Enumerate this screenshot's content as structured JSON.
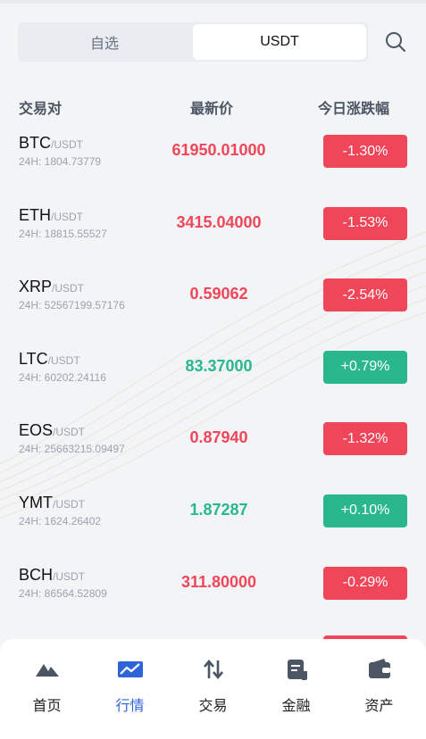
{
  "tabs": [
    {
      "label": "自选",
      "active": false
    },
    {
      "label": "USDT",
      "active": true
    }
  ],
  "header": {
    "pair": "交易对",
    "price": "最新价",
    "change": "今日涨跌幅"
  },
  "colors": {
    "up": "#2bb78d",
    "down": "#f0465a",
    "nav_active": "#2f64d8",
    "icon": "#4b5563"
  },
  "markets": [
    {
      "base": "BTC",
      "quote": "/USDT",
      "volume": "24H: 1804.73779",
      "price": "61950.01000",
      "change": "-1.30%",
      "direction": "down"
    },
    {
      "base": "ETH",
      "quote": "/USDT",
      "volume": "24H: 18815.55527",
      "price": "3415.04000",
      "change": "-1.53%",
      "direction": "down"
    },
    {
      "base": "XRP",
      "quote": "/USDT",
      "volume": "24H: 52567199.57176",
      "price": "0.59062",
      "change": "-2.54%",
      "direction": "down"
    },
    {
      "base": "LTC",
      "quote": "/USDT",
      "volume": "24H: 60202.24116",
      "price": "83.37000",
      "change": "+0.79%",
      "direction": "up"
    },
    {
      "base": "EOS",
      "quote": "/USDT",
      "volume": "24H: 25663215.09497",
      "price": "0.87940",
      "change": "-1.32%",
      "direction": "down"
    },
    {
      "base": "YMT",
      "quote": "/USDT",
      "volume": "24H: 1624.26402",
      "price": "1.87287",
      "change": "+0.10%",
      "direction": "up"
    },
    {
      "base": "BCH",
      "quote": "/USDT",
      "volume": "24H: 86564.52809",
      "price": "311.80000",
      "change": "-0.29%",
      "direction": "down"
    }
  ],
  "nav": [
    {
      "label": "首页",
      "icon": "mountain-icon",
      "active": false
    },
    {
      "label": "行情",
      "icon": "chart-trend-icon",
      "active": true
    },
    {
      "label": "交易",
      "icon": "swap-arrows-icon",
      "active": false
    },
    {
      "label": "金融",
      "icon": "document-icon",
      "active": false
    },
    {
      "label": "资产",
      "icon": "wallet-icon",
      "active": false
    }
  ]
}
